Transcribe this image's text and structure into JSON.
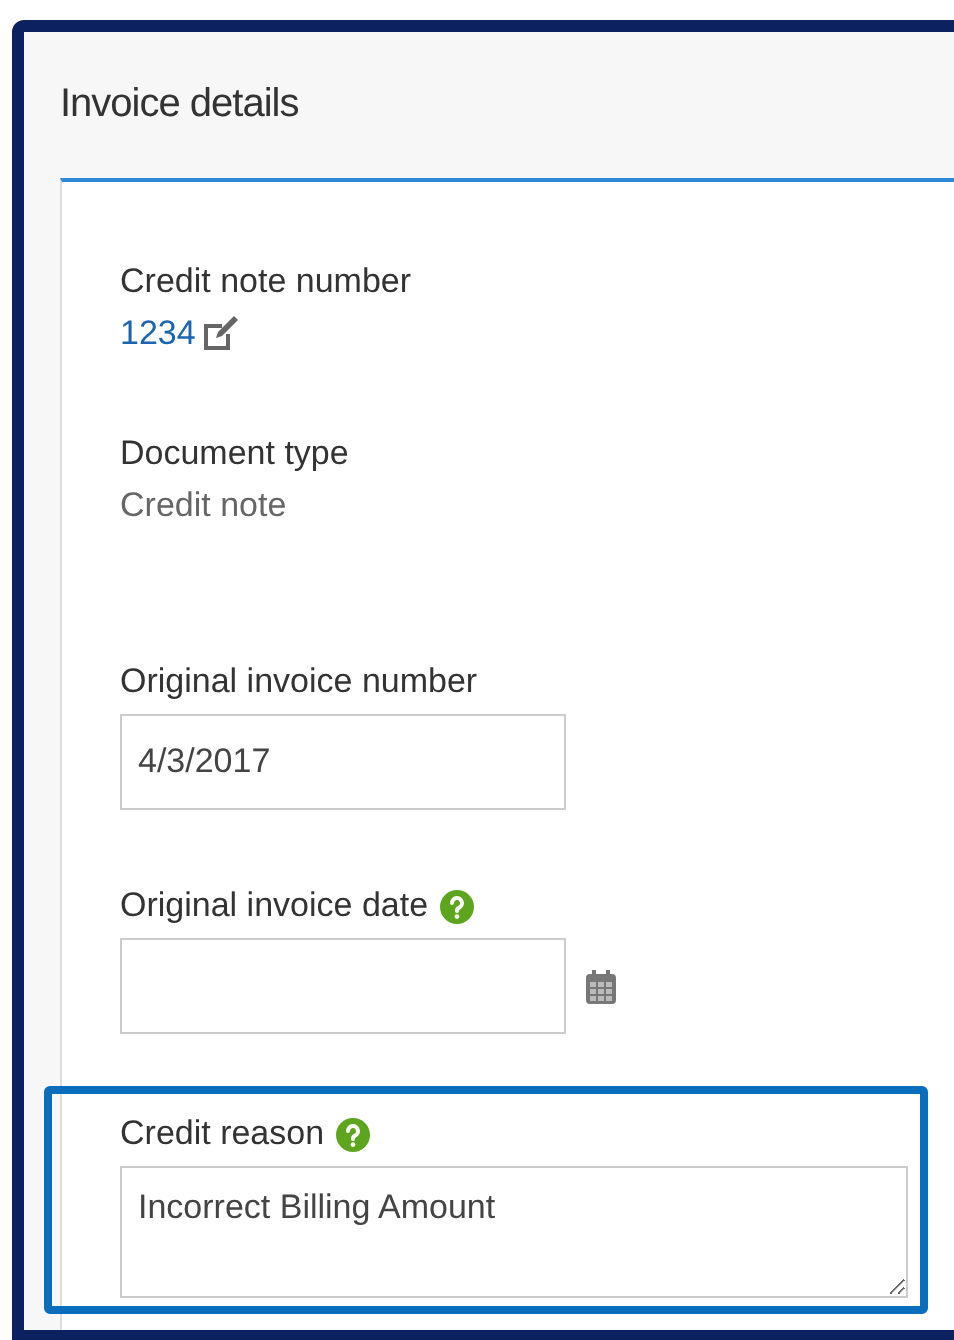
{
  "panel": {
    "title": "Invoice details"
  },
  "fields": [
    {
      "kind": "link",
      "label": "Credit note number",
      "value": "1234",
      "help": false,
      "highlighted": false
    },
    {
      "kind": "text",
      "label": "Document type",
      "value": "Credit note",
      "help": false,
      "highlighted": false
    },
    {
      "kind": "input",
      "label": "Original invoice number",
      "value": "4/3/2017",
      "help": false,
      "highlighted": false
    },
    {
      "kind": "date",
      "label": "Original invoice date",
      "help": true,
      "highlighted": false
    },
    {
      "kind": "textarea",
      "label": "Credit reason",
      "value": "Incorrect Billing Amount",
      "help": true,
      "highlighted": true
    }
  ]
}
